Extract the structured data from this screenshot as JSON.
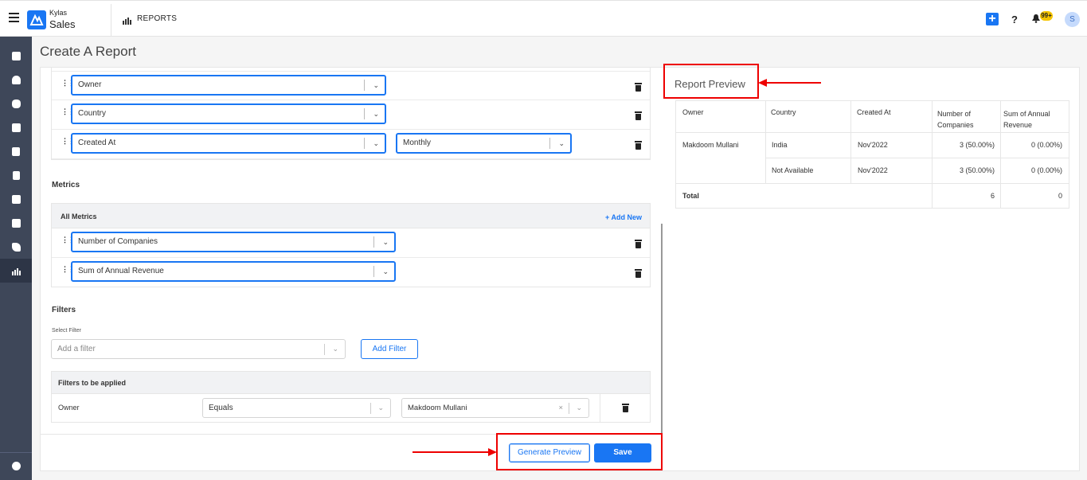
{
  "app": {
    "brand_top": "Kylas",
    "brand_bottom": "Sales",
    "section": "REPORTS"
  },
  "header": {
    "help": "?",
    "notification_badge": "99+",
    "avatar_initial": "S"
  },
  "page_title": "Create A Report",
  "dimensions": {
    "rows": [
      {
        "field": "Owner"
      },
      {
        "field": "Country"
      },
      {
        "field": "Created At",
        "group_by": "Monthly"
      }
    ]
  },
  "metrics": {
    "title": "Metrics",
    "header": "All Metrics",
    "add_new": "Add New",
    "rows": [
      "Number of Companies",
      "Sum of Annual Revenue"
    ]
  },
  "filters": {
    "title": "Filters",
    "select_label": "Select Filter",
    "select_placeholder": "Add a filter",
    "add_button": "Add Filter",
    "applied_header": "Filters to be applied",
    "applied": [
      {
        "field": "Owner",
        "operator": "Equals",
        "value": "Makdoom Mullani",
        "clear": "×"
      }
    ]
  },
  "actions": {
    "generate_preview": "Generate Preview",
    "save": "Save"
  },
  "preview": {
    "title": "Report Preview",
    "columns": [
      "Owner",
      "Country",
      "Created At",
      "Number of Companies",
      "Sum of Annual Revenue"
    ],
    "rows": [
      {
        "owner": "Makdoom Mullani",
        "country": "India",
        "created_at": "Nov'2022",
        "companies": "3 (50.00%)",
        "revenue": "0 (0.00%)"
      },
      {
        "owner": "",
        "country": "Not Available",
        "created_at": "Nov'2022",
        "companies": "3 (50.00%)",
        "revenue": "0 (0.00%)"
      }
    ],
    "total": {
      "label": "Total",
      "companies": "6",
      "revenue": "0"
    }
  },
  "colors": {
    "accent": "#1976f3",
    "sidebar": "#3e4759",
    "annotation": "#e00000"
  }
}
